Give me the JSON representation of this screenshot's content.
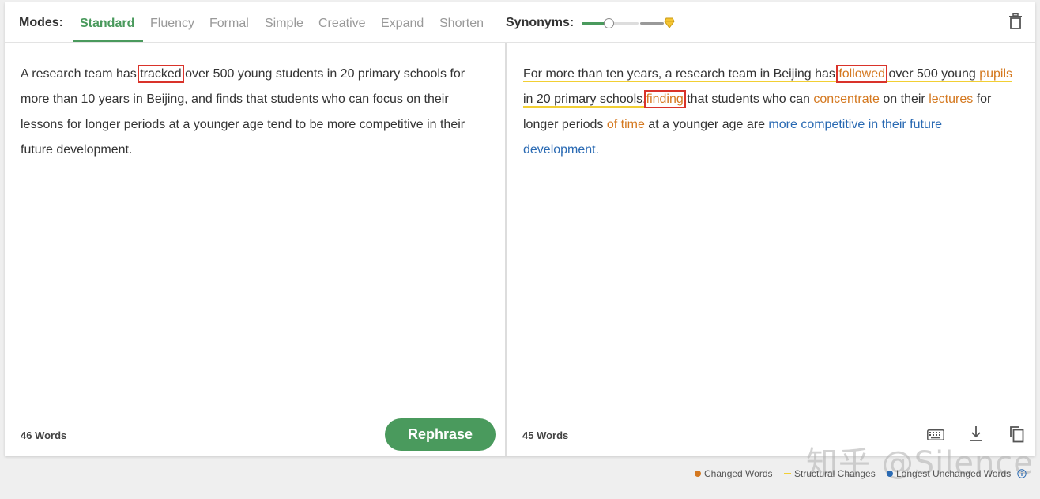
{
  "toolbar": {
    "modes_label": "Modes:",
    "modes": [
      "Standard",
      "Fluency",
      "Formal",
      "Simple",
      "Creative",
      "Expand",
      "Shorten"
    ],
    "active_mode": "Standard",
    "synonyms_label": "Synonyms:",
    "synonyms_level_fraction": 0.3
  },
  "input": {
    "t1": "A research team has ",
    "t_tracked": "tracked",
    "t2": " over 500 young students in 20 primary schools for more than 10 years in Beijing, and finds that students who can focus on their lessons for longer periods at a younger age tend to be more competitive in their future development.",
    "word_count": "46 Words",
    "rephrase_label": "Rephrase"
  },
  "output": {
    "s1": "For more than ten years, a research team in Beijing has ",
    "followed": "followed",
    "s2": " over 500 young",
    "pupils": "pupils",
    "s3": " in 20 primary schools,",
    "finding": "finding",
    "s4": " that students who can ",
    "concentrate": "concentrate",
    "s5": " on their ",
    "lectures": "lectures",
    "s6": " for longer periods ",
    "of_time": "of time",
    "s7": " at a younger age are ",
    "unchanged": "more competitive in their future development.",
    "word_count": "45 Words"
  },
  "legend": {
    "changed": "Changed Words",
    "structural": "Structural Changes",
    "unchanged": "Longest Unchanged Words"
  },
  "colors": {
    "accent": "#4a9a5d",
    "changed": "#d4781f",
    "structural": "#f2cf34",
    "unchanged": "#2a6ab3",
    "highlight_box": "#d9332a"
  },
  "watermark": "知乎 @Silence"
}
